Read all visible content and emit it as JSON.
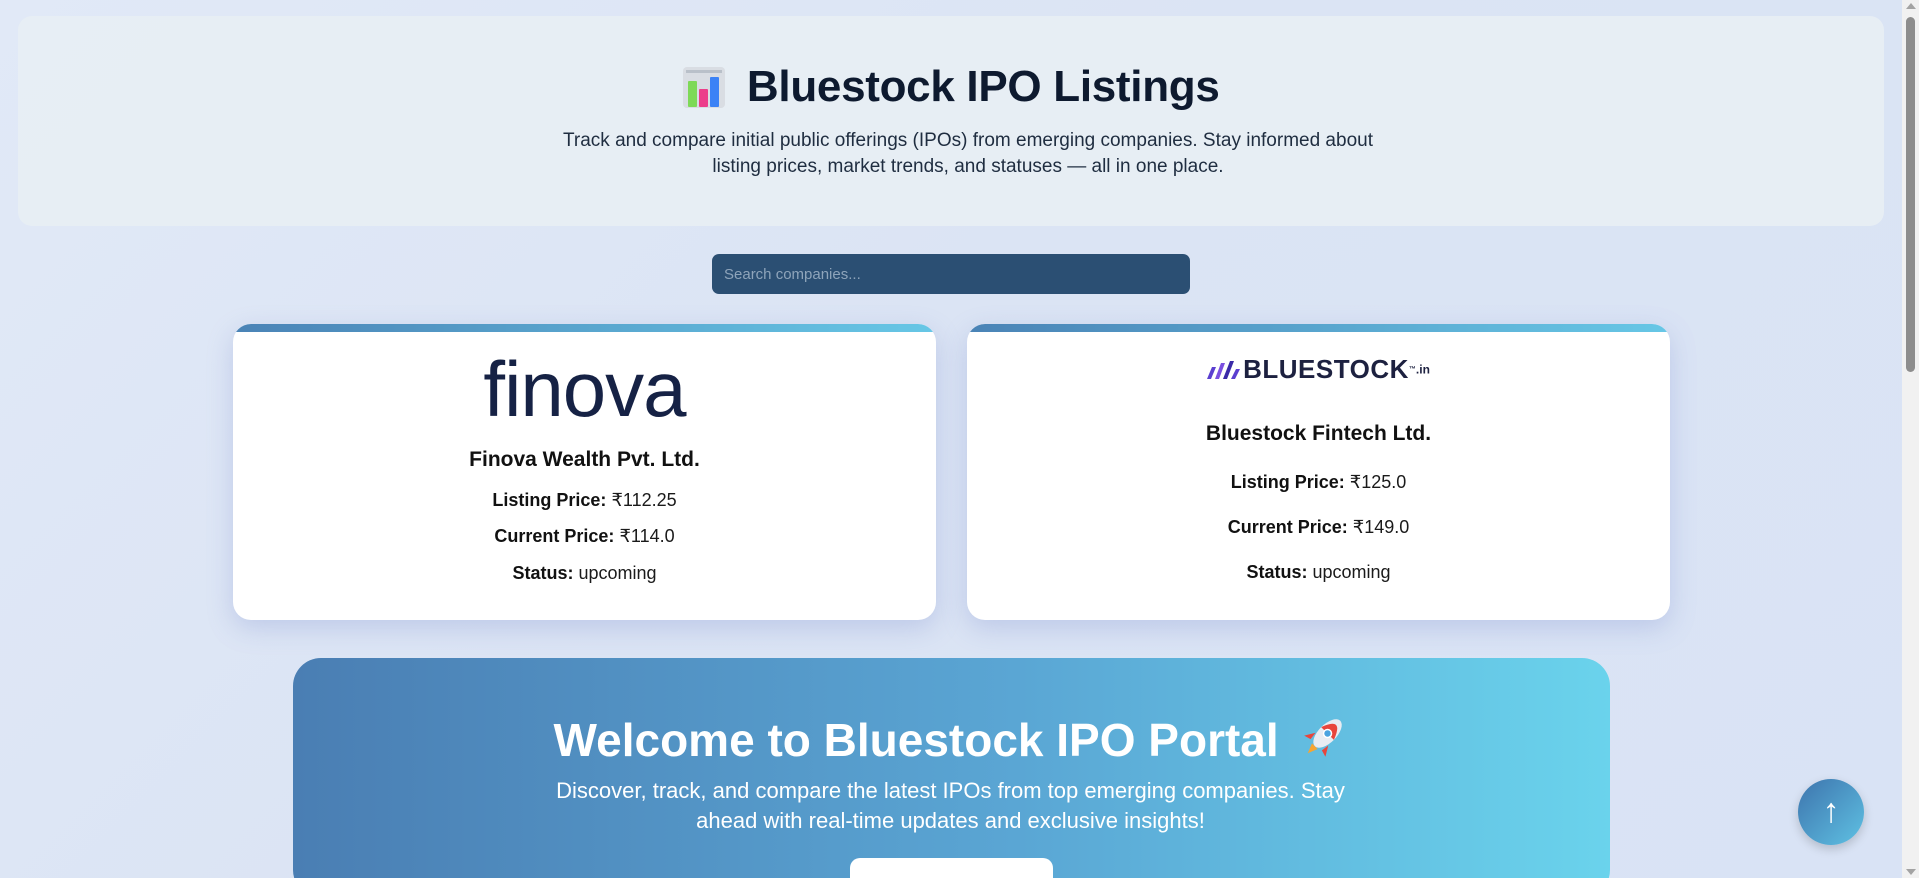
{
  "header": {
    "title": "Bluestock IPO Listings",
    "title_icon": "bar-chart-icon",
    "subtitle": "Track and compare initial public offerings (IPOs) from emerging companies. Stay informed about listing prices, market trends, and statuses — all in one place."
  },
  "search": {
    "placeholder": "Search companies...",
    "value": ""
  },
  "labels": {
    "listing_price": "Listing Price:",
    "current_price": "Current Price:",
    "status": "Status:"
  },
  "cards": [
    {
      "logo_text": "finova",
      "name": "Finova Wealth Pvt. Ltd.",
      "listing_price": "₹112.25",
      "current_price": "₹114.0",
      "status": "upcoming"
    },
    {
      "logo_text": "BLUESTOCK",
      "logo_suffix": ".in",
      "logo_tm": "™",
      "name": "Bluestock Fintech Ltd.",
      "listing_price": "₹125.0",
      "current_price": "₹149.0",
      "status": "upcoming"
    }
  ],
  "welcome": {
    "title": "Welcome to Bluestock IPO Portal",
    "title_icon": "rocket-icon",
    "text": "Discover, track, and compare the latest IPOs from top emerging companies. Stay ahead with real-time updates and exclusive insights!"
  },
  "scroll_top": {
    "icon": "arrow-up-icon",
    "glyph": "↑"
  },
  "colors": {
    "accent": "#2b4f73",
    "card_bar_start": "#4a83b6",
    "card_bar_end": "#67c7e6",
    "title": "#0e1a2f"
  }
}
